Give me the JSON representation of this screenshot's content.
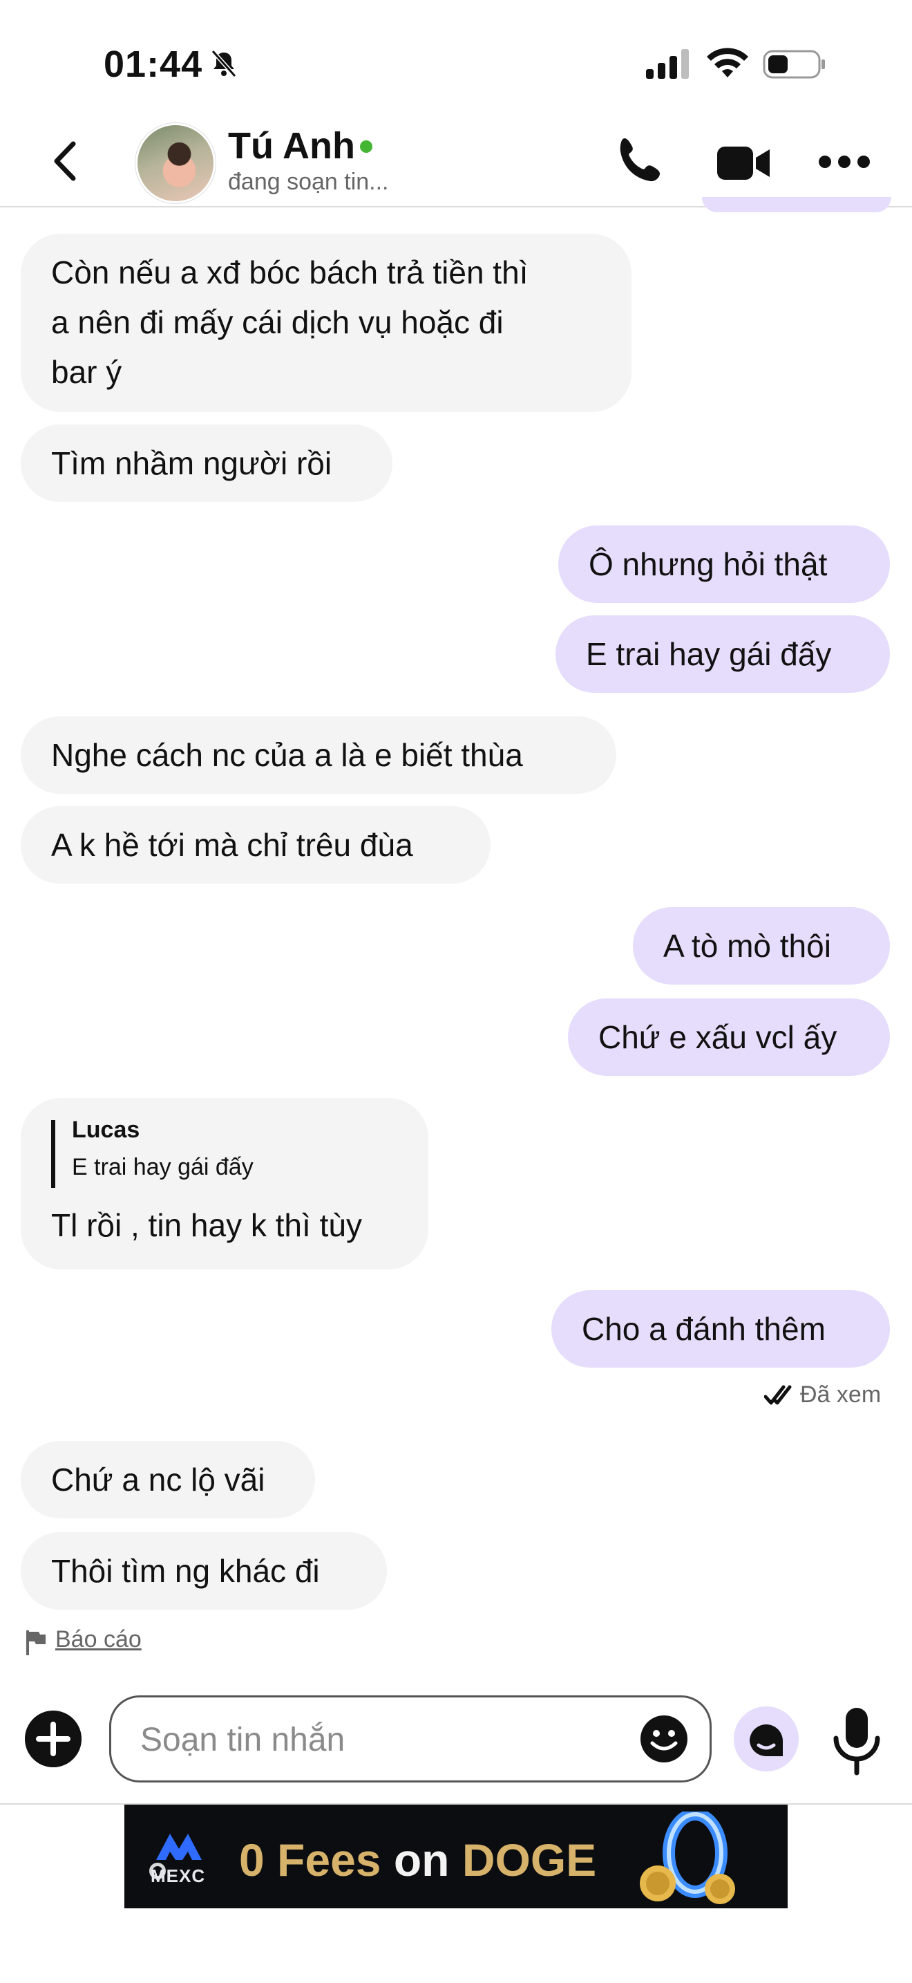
{
  "status_bar": {
    "time": "01:44"
  },
  "header": {
    "contact_name": "Tú Anh",
    "contact_status": "đang soạn tin..."
  },
  "messages": [
    {
      "side": "in",
      "text_lines": [
        "Còn nếu a xđ bóc bách trả tiền thì",
        "a nên đi mấy cái dịch vụ hoặc đi",
        "bar ý"
      ]
    },
    {
      "side": "in",
      "text": "Tìm nhầm người rồi"
    },
    {
      "side": "out",
      "text": "Ô nhưng hỏi thật"
    },
    {
      "side": "out",
      "text": "E trai hay gái đấy"
    },
    {
      "side": "in",
      "text": "Nghe cách nc của a là e biết thùa"
    },
    {
      "side": "in",
      "text": "A k hề tới mà chỉ trêu đùa"
    },
    {
      "side": "out",
      "text": "A tò mò thôi"
    },
    {
      "side": "out",
      "text": "Chứ e xấu vcl ấy"
    },
    {
      "side": "in",
      "reply_to_name": "Lucas",
      "reply_to_text": "E trai hay gái đấy",
      "text": "Tl rồi , tin hay k thì tùy"
    },
    {
      "side": "out",
      "text": "Cho a đánh thêm"
    },
    {
      "side": "in",
      "text": "Chứ a nc lộ vãi"
    },
    {
      "side": "in",
      "text": "Thôi tìm ng khác đi"
    }
  ],
  "seen_label": "Đã xem",
  "report_label": "Báo cáo",
  "composer": {
    "placeholder": "Soạn tin nhắn",
    "value": ""
  },
  "ad": {
    "brand": "MEXC",
    "headline_gold": "0 Fees",
    "headline_white": "on",
    "headline_gold2": "DOGE"
  },
  "colors": {
    "outgoing_bubble": "#e6dcfb",
    "incoming_bubble": "#f4f4f4",
    "online": "#44b532"
  }
}
